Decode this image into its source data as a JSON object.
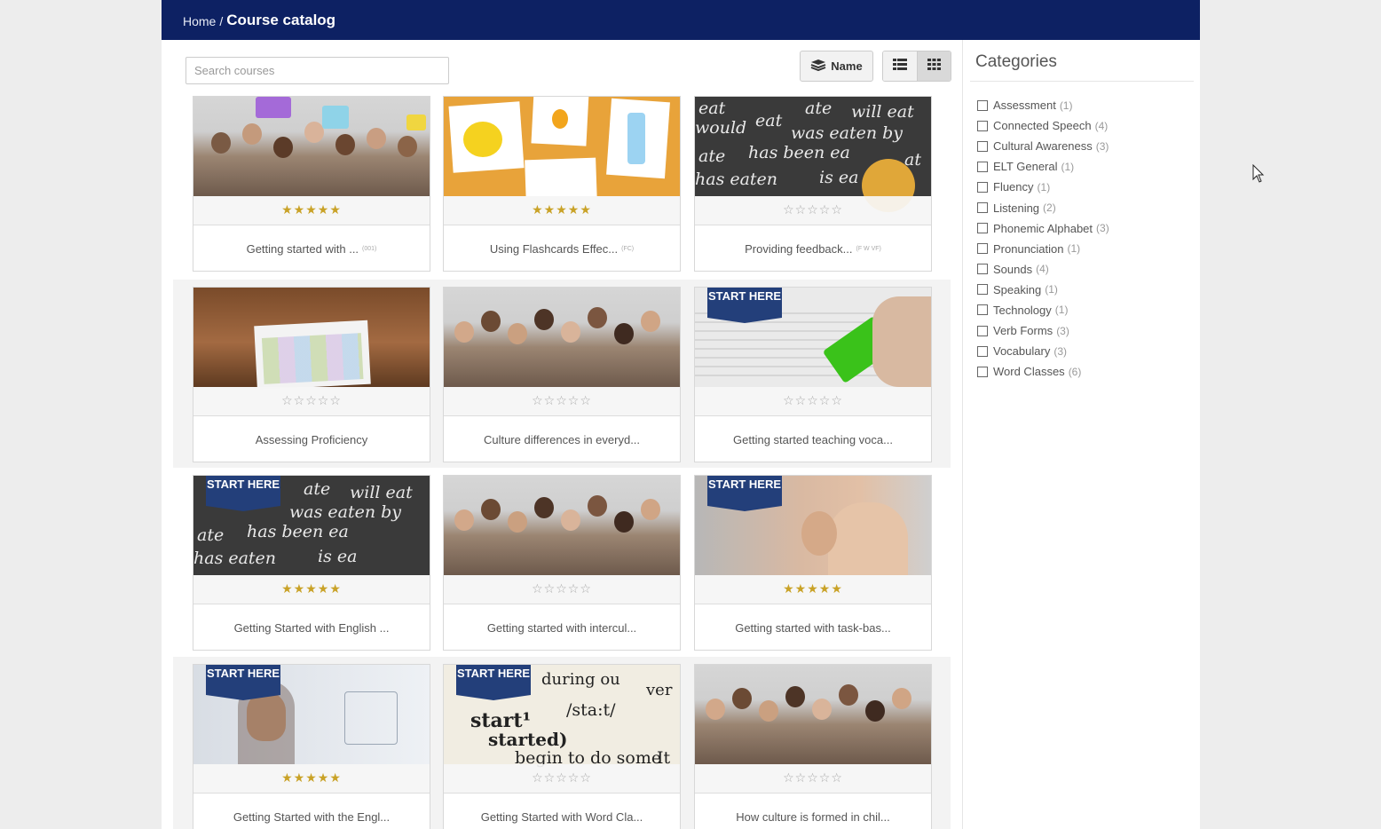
{
  "breadcrumb": {
    "home": "Home",
    "separator": "/",
    "current": "Course catalog"
  },
  "search": {
    "placeholder": "Search courses",
    "value": ""
  },
  "toolbar": {
    "sort_label": "Name",
    "sort_icon": "layers-icon",
    "list_view_icon": "list-icon",
    "grid_view_icon": "grid-icon",
    "active_view": "grid"
  },
  "courses": [
    {
      "title": "Getting started with ...",
      "code": "(001)",
      "rating": 5,
      "badge": ""
    },
    {
      "title": "Using Flashcards Effec...",
      "code": "(FC)",
      "rating": 5,
      "badge": ""
    },
    {
      "title": "Providing feedback...",
      "code": "(F W VF)",
      "rating": 0,
      "badge": ""
    },
    {
      "title": "Assessing Proficiency",
      "code": "",
      "rating": 0,
      "badge": ""
    },
    {
      "title": "Culture differences in everyd...",
      "code": "",
      "rating": 0,
      "badge": ""
    },
    {
      "title": "Getting started teaching voca...",
      "code": "",
      "rating": 0,
      "badge": "START HERE"
    },
    {
      "title": "Getting Started with English ...",
      "code": "",
      "rating": 5,
      "badge": "START HERE"
    },
    {
      "title": "Getting started with intercul...",
      "code": "",
      "rating": 0,
      "badge": ""
    },
    {
      "title": "Getting started with task-bas...",
      "code": "",
      "rating": 5,
      "badge": "START HERE"
    },
    {
      "title": "Getting Started with the Engl...",
      "code": "",
      "rating": 5,
      "badge": "START HERE"
    },
    {
      "title": "Getting Started with Word Cla...",
      "code": "",
      "rating": 0,
      "badge": "START HERE"
    },
    {
      "title": "How culture is formed in chil...",
      "code": "",
      "rating": 0,
      "badge": ""
    }
  ],
  "thumb_text": {
    "chalk": [
      "eat",
      "ate",
      "will eat",
      "would",
      "eat",
      "was eaten by",
      "ate",
      "has been ea",
      "at",
      "has eaten",
      "is ea"
    ],
    "dict": [
      "start¹",
      "/sta:t/",
      "started)",
      "begin to do some",
      "It",
      "during ou",
      "ver"
    ],
    "flashcard_note": ""
  },
  "sidebar": {
    "title": "Categories",
    "categories": [
      {
        "label": "Assessment",
        "count": "(1)"
      },
      {
        "label": "Connected Speech",
        "count": "(4)"
      },
      {
        "label": "Cultural Awareness",
        "count": "(3)"
      },
      {
        "label": "ELT General",
        "count": "(1)"
      },
      {
        "label": "Fluency",
        "count": "(1)"
      },
      {
        "label": "Listening",
        "count": "(2)"
      },
      {
        "label": "Phonemic Alphabet",
        "count": "(3)"
      },
      {
        "label": "Pronunciation",
        "count": "(1)"
      },
      {
        "label": "Sounds",
        "count": "(4)"
      },
      {
        "label": "Speaking",
        "count": "(1)"
      },
      {
        "label": "Technology",
        "count": "(1)"
      },
      {
        "label": "Verb Forms",
        "count": "(3)"
      },
      {
        "label": "Vocabulary",
        "count": "(3)"
      },
      {
        "label": "Word Classes",
        "count": "(6)"
      }
    ]
  },
  "colors": {
    "header": "#0d2163",
    "badge": "#233f7a",
    "star_filled": "#c9a227",
    "star_empty": "#aaaaaa"
  }
}
